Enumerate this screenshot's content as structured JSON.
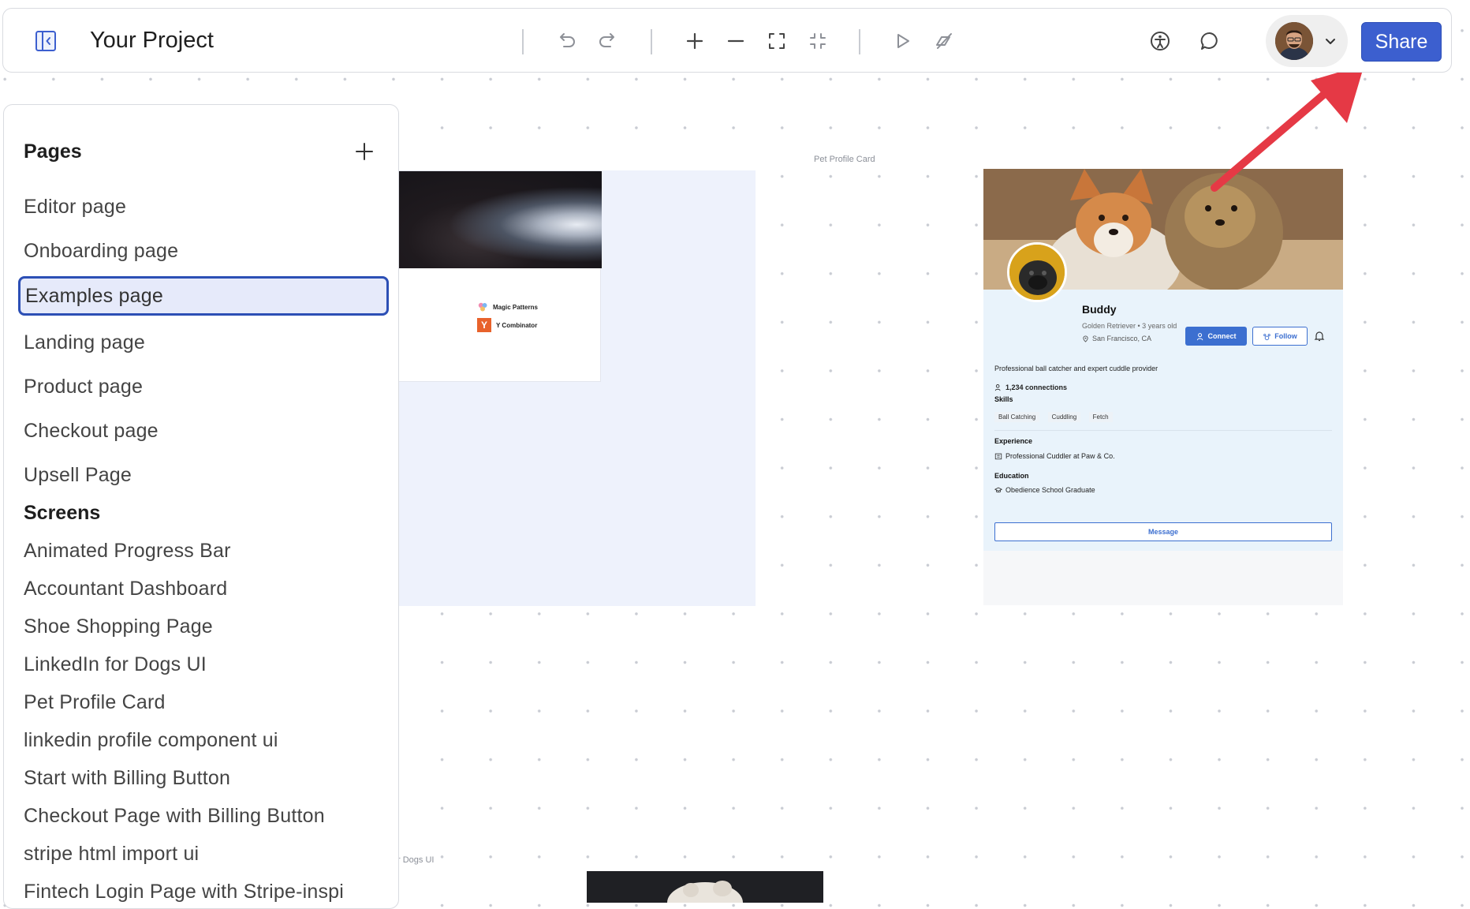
{
  "toolbar": {
    "title": "Your Project",
    "share_label": "Share",
    "icons": [
      "sidebar-toggle-icon",
      "undo-icon",
      "redo-icon",
      "zoom-in-icon",
      "zoom-out-icon",
      "fit-screen-icon",
      "collapse-icon",
      "play-icon",
      "hide-preview-icon",
      "accessibility-icon",
      "comment-icon",
      "chevron-down-icon"
    ]
  },
  "sidebar": {
    "title": "Pages",
    "pages": [
      {
        "label": "Editor page"
      },
      {
        "label": "Onboarding page"
      },
      {
        "label": "Examples page",
        "active": true
      },
      {
        "label": "Landing page"
      },
      {
        "label": "Product page"
      },
      {
        "label": "Checkout page"
      },
      {
        "label": "Upsell Page"
      }
    ],
    "screens_title": "Screens",
    "screens": [
      {
        "label": "Animated Progress Bar"
      },
      {
        "label": "Accountant Dashboard"
      },
      {
        "label": "Shoe Shopping Page"
      },
      {
        "label": "LinkedIn for Dogs UI"
      },
      {
        "label": "Pet Profile Card"
      },
      {
        "label": "linkedin profile component ui"
      },
      {
        "label": "Start with Billing Button"
      },
      {
        "label": "Checkout Page with Billing Button"
      },
      {
        "label": "stripe html import ui"
      },
      {
        "label": "Fintech Login Page with Stripe-inspi"
      }
    ]
  },
  "canvas": {
    "frame_a": {
      "logos": [
        {
          "label": "Magic Patterns"
        },
        {
          "label": "Y Combinator",
          "glyph": "Y"
        }
      ]
    },
    "pet_card_label": "Pet Profile Card",
    "dogs_label": "r Dogs UI",
    "pet": {
      "name": "Buddy",
      "subtitle": "Golden Retriever • 3 years old",
      "location": "San Francisco, CA",
      "connect_label": "Connect",
      "follow_label": "Follow",
      "bio": "Professional ball catcher and expert cuddle provider",
      "connections": "1,234 connections",
      "skills_title": "Skills",
      "skills": [
        "Ball Catching",
        "Cuddling",
        "Fetch"
      ],
      "experience_title": "Experience",
      "experience": "Professional Cuddler at Paw & Co.",
      "education_title": "Education",
      "education": "Obedience School Graduate",
      "message_label": "Message"
    }
  },
  "colors": {
    "accent": "#3c5fcf",
    "arrow": "#e53945",
    "active_border": "#2c4fb5"
  }
}
